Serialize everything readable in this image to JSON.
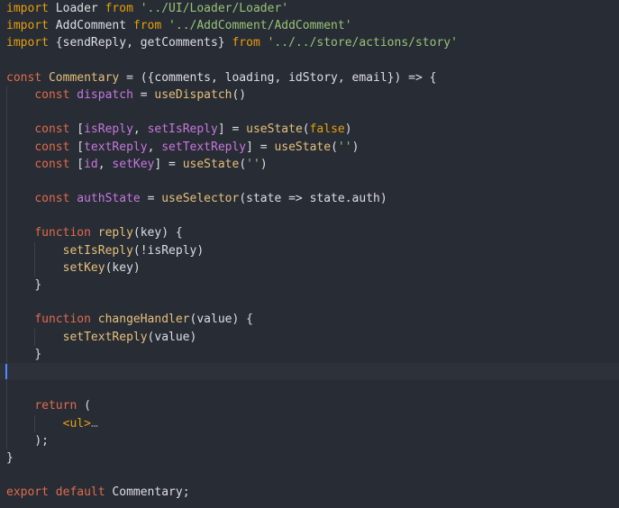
{
  "editor": {
    "colors": {
      "background": "#282c34",
      "current_line": "#2c313a",
      "keyword": "#e5a00d",
      "string": "#98c379",
      "function": "#e5c07b",
      "variable": "#c678dd",
      "text": "#dcdfe4"
    },
    "lines": [
      {
        "text": "import Loader from '../UI/Loader/Loader'"
      },
      {
        "text": "import AddComment from '../AddComment/AddComment'"
      },
      {
        "text": "import {sendReply, getComments} from '../../store/actions/story'"
      },
      {
        "text": ""
      },
      {
        "text": "const Commentary = ({comments, loading, idStory, email}) => {"
      },
      {
        "text": "    const dispatch = useDispatch()"
      },
      {
        "text": ""
      },
      {
        "text": "    const [isReply, setIsReply] = useState(false)"
      },
      {
        "text": "    const [textReply, setTextReply] = useState('')"
      },
      {
        "text": "    const [id, setKey] = useState('')"
      },
      {
        "text": ""
      },
      {
        "text": "    const authState = useSelector(state => state.auth)"
      },
      {
        "text": ""
      },
      {
        "text": "    function reply(key) {"
      },
      {
        "text": "        setIsReply(!isReply)"
      },
      {
        "text": "        setKey(key)"
      },
      {
        "text": "    }"
      },
      {
        "text": ""
      },
      {
        "text": "    function changeHandler(value) {"
      },
      {
        "text": "        setTextReply(value)"
      },
      {
        "text": "    }"
      },
      {
        "text": ""
      },
      {
        "text": ""
      },
      {
        "text": "    return ("
      },
      {
        "text": "        <ul>…"
      },
      {
        "text": "    );"
      },
      {
        "text": "}"
      },
      {
        "text": ""
      },
      {
        "text": "export default Commentary;"
      }
    ]
  }
}
